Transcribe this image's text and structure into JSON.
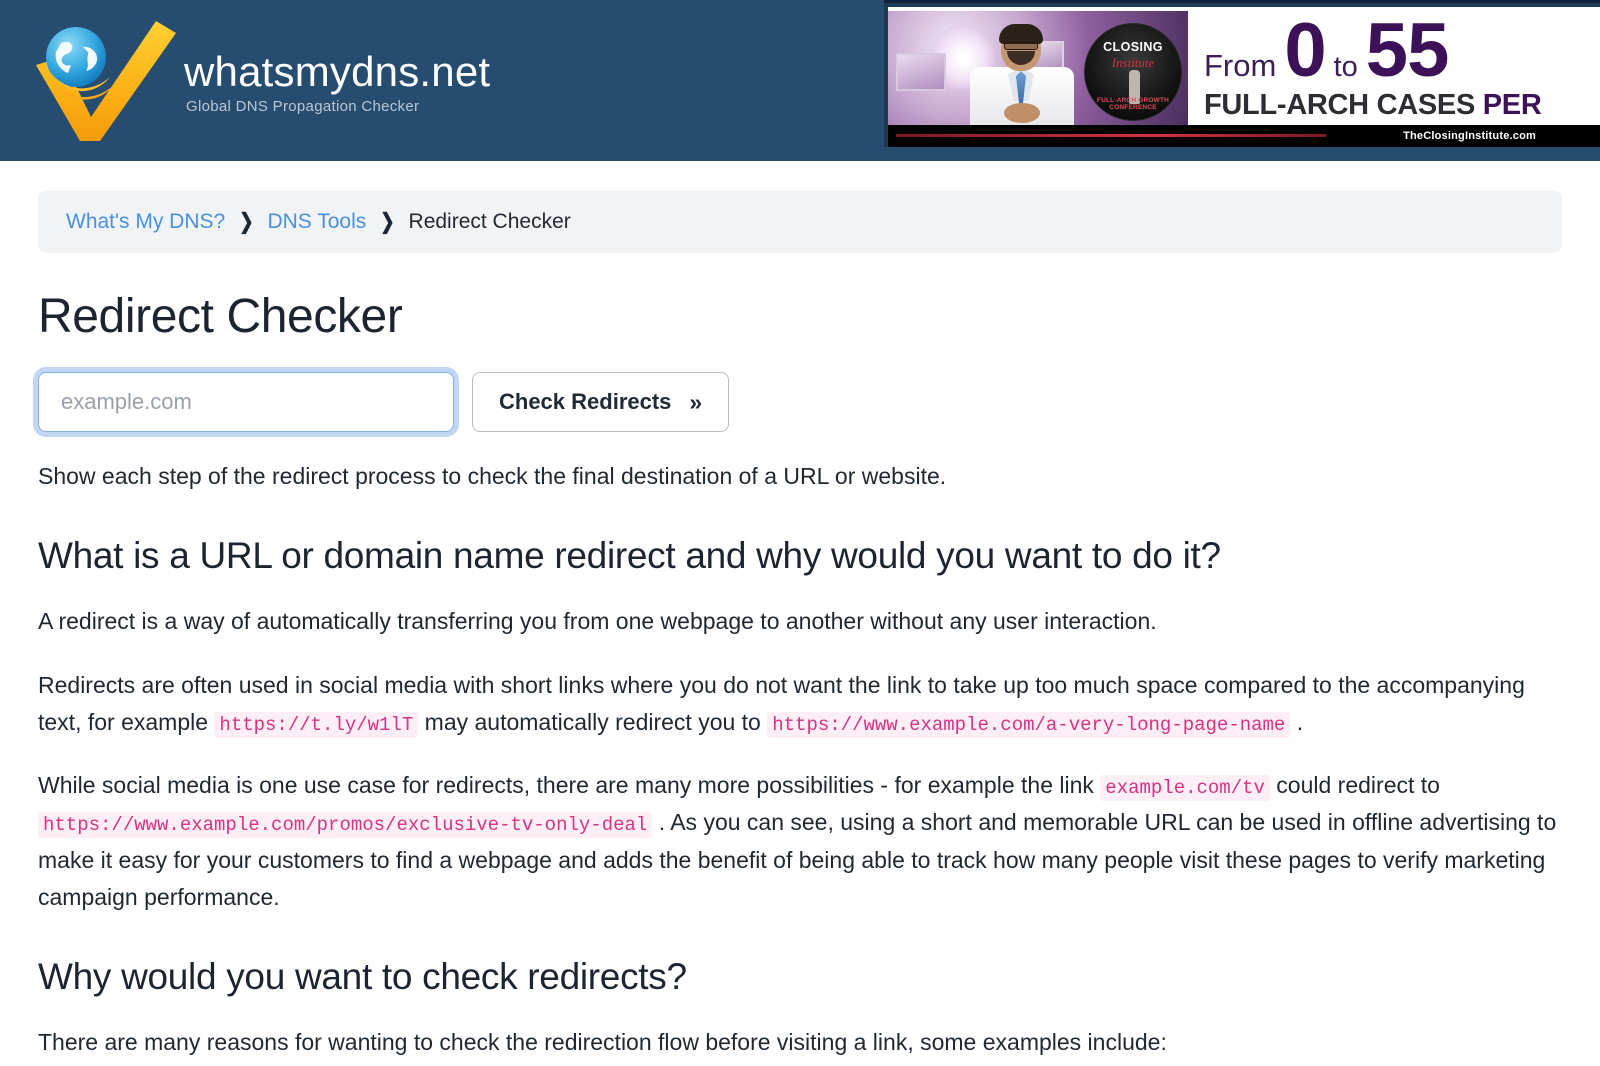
{
  "header": {
    "logo": {
      "title": "whatsmydns.net",
      "subtitle": "Global DNS Propagation Checker",
      "icon": "globe-checkmark-logo"
    },
    "ad": {
      "from_label": "From",
      "number_start": "0",
      "to_label": "to",
      "number_end": "55",
      "headline_plain": "FULL-ARCH CASES ",
      "headline_accent": "PER",
      "logo_title": "CLOSING",
      "logo_script": "Institute",
      "logo_bottom": "FULL-ARCH GROWTH CONFERENCE",
      "footer_url": "TheClosingInstitute.com"
    }
  },
  "breadcrumb": {
    "items": [
      {
        "label": "What's My DNS?",
        "is_link": true
      },
      {
        "label": "DNS Tools",
        "is_link": true
      },
      {
        "label": "Redirect Checker",
        "is_link": false
      }
    ],
    "separator": "❯"
  },
  "main": {
    "title": "Redirect Checker",
    "form": {
      "input_value": "",
      "input_placeholder": "example.com",
      "button_label": "Check Redirects",
      "button_icon": "double-chevron-right-icon",
      "button_chevron": "»"
    },
    "lead": "Show each step of the redirect process to check the final destination of a URL or website.",
    "sections": [
      {
        "heading": "What is a URL or domain name redirect and why would you want to do it?",
        "paragraph_1": "A redirect is a way of automatically transferring you from one webpage to another without any user interaction.",
        "paragraph_2_part_1": "Redirects are often used in social media with short links where you do not want the link to take up too much space compared to the accompanying text, for example ",
        "paragraph_2_code_1": "https://t.ly/w1lT",
        "paragraph_2_part_2": " may automatically redirect you to ",
        "paragraph_2_code_2": "https://www.example.com/a-very-long-page-name",
        "paragraph_2_part_3": " .",
        "paragraph_3_part_1": "While social media is one use case for redirects, there are many more possibilities - for example the link ",
        "paragraph_3_code_1": "example.com/tv",
        "paragraph_3_part_2": " could redirect to ",
        "paragraph_3_code_2": "https://www.example.com/promos/exclusive-tv-only-deal",
        "paragraph_3_part_3": " . As you can see, using a short and memorable URL can be used in offline advertising to make it easy for your customers to find a webpage and adds the benefit of being able to track how many people visit these pages to verify marketing campaign performance."
      },
      {
        "heading": "Why would you want to check redirects?",
        "paragraph_1": "There are many reasons for wanting to check the redirection flow before visiting a link, some examples include:"
      }
    ]
  },
  "colors": {
    "header_bg": "#264d70",
    "link_blue": "#4a90e2",
    "breadcrumb_bg": "#f2f3f5",
    "code_text": "#d63384",
    "code_bg": "#fdeff5",
    "focus_ring": "#86b0e8",
    "ad_purple": "#3d1158"
  }
}
